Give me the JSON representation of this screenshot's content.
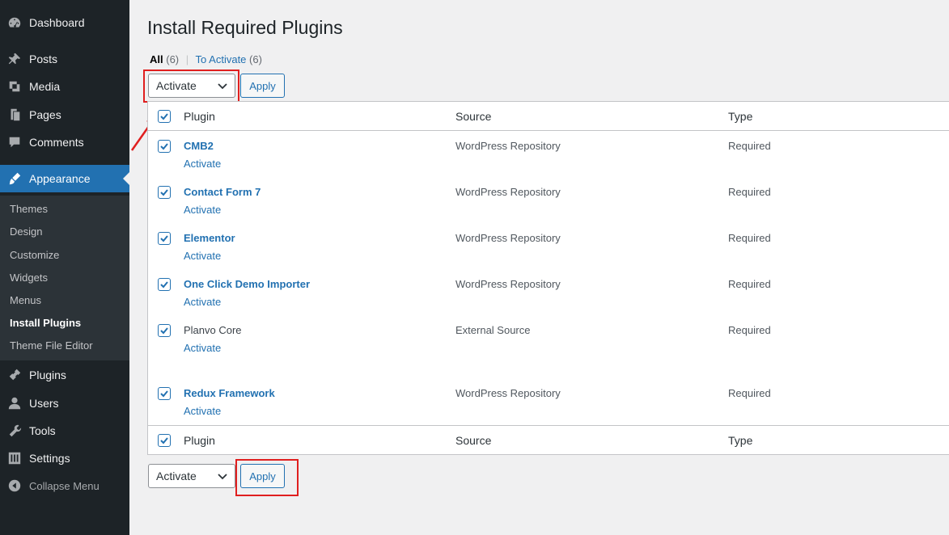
{
  "sidebar": {
    "items": [
      {
        "label": "Dashboard",
        "icon": "dashboard-icon"
      },
      {
        "label": "Posts",
        "icon": "pin-icon"
      },
      {
        "label": "Media",
        "icon": "media-icon"
      },
      {
        "label": "Pages",
        "icon": "pages-icon"
      },
      {
        "label": "Comments",
        "icon": "comment-icon"
      },
      {
        "label": "Appearance",
        "icon": "brush-icon"
      },
      {
        "label": "Plugins",
        "icon": "plugin-icon"
      },
      {
        "label": "Users",
        "icon": "user-icon"
      },
      {
        "label": "Tools",
        "icon": "wrench-icon"
      },
      {
        "label": "Settings",
        "icon": "sliders-icon"
      },
      {
        "label": "Collapse Menu",
        "icon": "collapse-icon"
      }
    ],
    "submenu": [
      "Themes",
      "Design",
      "Customize",
      "Widgets",
      "Menus",
      "Install Plugins",
      "Theme File Editor"
    ]
  },
  "page": {
    "title": "Install Required Plugins",
    "filters": {
      "all_label": "All",
      "all_count": "(6)",
      "to_activate_label": "To Activate",
      "to_activate_count": "(6)",
      "separator": "|"
    }
  },
  "bulk_top": {
    "select_value": "Activate",
    "apply_label": "Apply"
  },
  "bulk_bottom": {
    "select_value": "Activate",
    "apply_label": "Apply"
  },
  "table": {
    "columns": [
      "Plugin",
      "Source",
      "Type"
    ],
    "rows": [
      {
        "name": "CMB2",
        "action": "Activate",
        "source": "WordPress Repository",
        "type": "Required",
        "checked": true
      },
      {
        "name": "Contact Form 7",
        "action": "Activate",
        "source": "WordPress Repository",
        "type": "Required",
        "checked": true
      },
      {
        "name": "Elementor",
        "action": "Activate",
        "source": "WordPress Repository",
        "type": "Required",
        "checked": true
      },
      {
        "name": "One Click Demo Importer",
        "action": "Activate",
        "source": "WordPress Repository",
        "type": "Required",
        "checked": true
      },
      {
        "name": "Planvo Core",
        "action": "Activate",
        "source": "External Source",
        "type": "Required",
        "checked": true
      },
      {
        "name": "Redux Framework",
        "action": "Activate",
        "source": "WordPress Repository",
        "type": "Required",
        "checked": true
      }
    ]
  },
  "colors": {
    "accent": "#2271b1",
    "sidebar_bg": "#1d2327",
    "highlight": "#e01f1f"
  }
}
